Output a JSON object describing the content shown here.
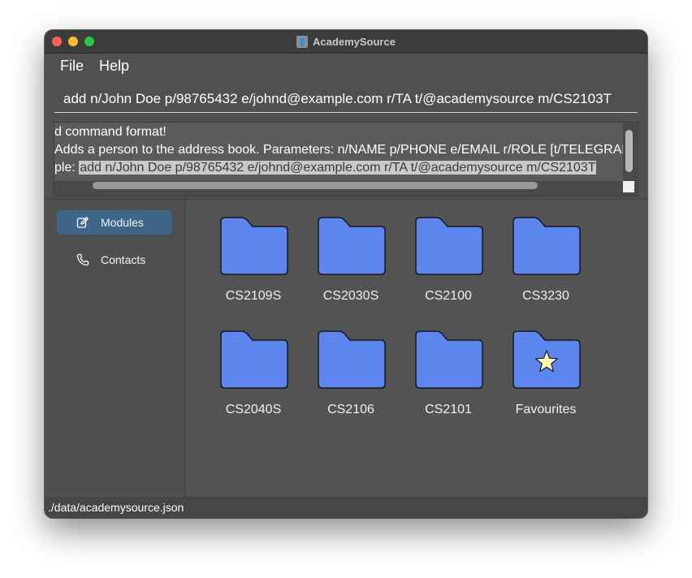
{
  "window": {
    "title": "AcademySource",
    "app_icon": "academysource-logo-icon"
  },
  "menu": {
    "items": [
      {
        "label": "File"
      },
      {
        "label": "Help"
      }
    ]
  },
  "command": {
    "value": "add n/John Doe p/98765432 e/johnd@example.com r/TA t/@academysource m/CS2103T"
  },
  "result": {
    "line1": "d command format!",
    "line2": "Adds a person to the address book. Parameters: n/NAME p/PHONE e/EMAIL r/ROLE [t/TELEGRAM",
    "line3_prefix": "ple: ",
    "line3_selected": "add n/John Doe p/98765432 e/johnd@example.com r/TA t/@academysource m/CS2103T"
  },
  "sidebar": {
    "items": [
      {
        "label": "Modules",
        "icon": "edit-icon",
        "active": true
      },
      {
        "label": "Contacts",
        "icon": "phone-icon",
        "active": false
      }
    ]
  },
  "folders": [
    {
      "label": "CS2109S",
      "icon": "folder-icon"
    },
    {
      "label": "CS2030S",
      "icon": "folder-icon"
    },
    {
      "label": "CS2100",
      "icon": "folder-icon"
    },
    {
      "label": "CS3230",
      "icon": "folder-icon"
    },
    {
      "label": "CS2040S",
      "icon": "folder-icon"
    },
    {
      "label": "CS2106",
      "icon": "folder-icon"
    },
    {
      "label": "CS2101",
      "icon": "folder-icon"
    },
    {
      "label": "Favourites",
      "icon": "star-folder-icon"
    }
  ],
  "status": {
    "path": "./data/academysource.json"
  },
  "colors": {
    "folder_fill": "#5d86ee",
    "folder_stroke": "#15191f",
    "star_fill": "#fffcb8",
    "active_nav": "#3f6688",
    "window_bg": "#505050"
  }
}
